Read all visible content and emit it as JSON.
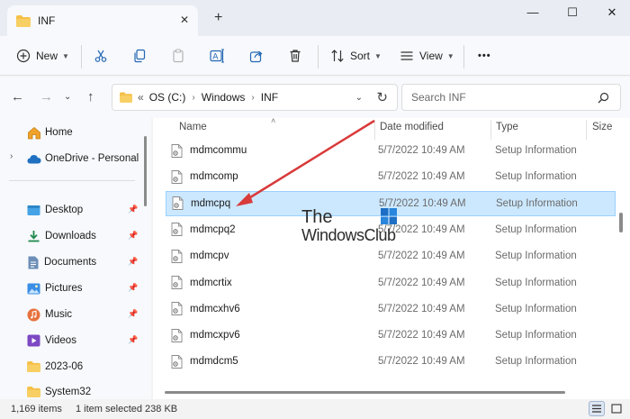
{
  "window": {
    "tab_title": "INF",
    "tab_close": "✕",
    "new_tab": "+",
    "controls": {
      "minimize": "—",
      "maximize": "☐",
      "close": "✕"
    }
  },
  "toolbar": {
    "new_label": "New",
    "sort_label": "Sort",
    "view_label": "View",
    "more": "•••"
  },
  "address": {
    "overflow": "«",
    "crumbs": [
      "OS (C:)",
      "Windows",
      "INF"
    ],
    "search_placeholder": "Search INF"
  },
  "sidebar": {
    "items": [
      {
        "label": "Home",
        "icon": "home-icon"
      },
      {
        "label": "OneDrive - Personal",
        "icon": "cloud-icon"
      },
      {
        "label": "Desktop",
        "icon": "desktop-icon",
        "pinned": true
      },
      {
        "label": "Downloads",
        "icon": "download-icon",
        "pinned": true
      },
      {
        "label": "Documents",
        "icon": "documents-icon",
        "pinned": true
      },
      {
        "label": "Pictures",
        "icon": "pictures-icon",
        "pinned": true
      },
      {
        "label": "Music",
        "icon": "music-icon",
        "pinned": true
      },
      {
        "label": "Videos",
        "icon": "videos-icon",
        "pinned": true
      },
      {
        "label": "2023-06",
        "icon": "folder-icon"
      },
      {
        "label": "System32",
        "icon": "folder-icon"
      }
    ]
  },
  "columns": {
    "name": "Name",
    "date": "Date modified",
    "type": "Type",
    "size": "Size"
  },
  "files": [
    {
      "name": "mdmcommu",
      "date": "5/7/2022 10:49 AM",
      "type": "Setup Information",
      "selected": false
    },
    {
      "name": "mdmcomp",
      "date": "5/7/2022 10:49 AM",
      "type": "Setup Information",
      "selected": false
    },
    {
      "name": "mdmcpq",
      "date": "5/7/2022 10:49 AM",
      "type": "Setup Information",
      "selected": true
    },
    {
      "name": "mdmcpq2",
      "date": "5/7/2022 10:49 AM",
      "type": "Setup Information",
      "selected": false
    },
    {
      "name": "mdmcpv",
      "date": "5/7/2022 10:49 AM",
      "type": "Setup Information",
      "selected": false
    },
    {
      "name": "mdmcrtix",
      "date": "5/7/2022 10:49 AM",
      "type": "Setup Information",
      "selected": false
    },
    {
      "name": "mdmcxhv6",
      "date": "5/7/2022 10:49 AM",
      "type": "Setup Information",
      "selected": false
    },
    {
      "name": "mdmcxpv6",
      "date": "5/7/2022 10:49 AM",
      "type": "Setup Information",
      "selected": false
    },
    {
      "name": "mdmdcm5",
      "date": "5/7/2022 10:49 AM",
      "type": "Setup Information",
      "selected": false
    }
  ],
  "watermark": {
    "line1": "The",
    "line2": "WindowsClub"
  },
  "status": {
    "count": "1,169 items",
    "selection": "1 item selected  238 KB"
  },
  "colors": {
    "accent": "#0067c0",
    "selection": "#cce8ff",
    "arrow": "#d93a3a",
    "folder": "#f5c04a"
  }
}
